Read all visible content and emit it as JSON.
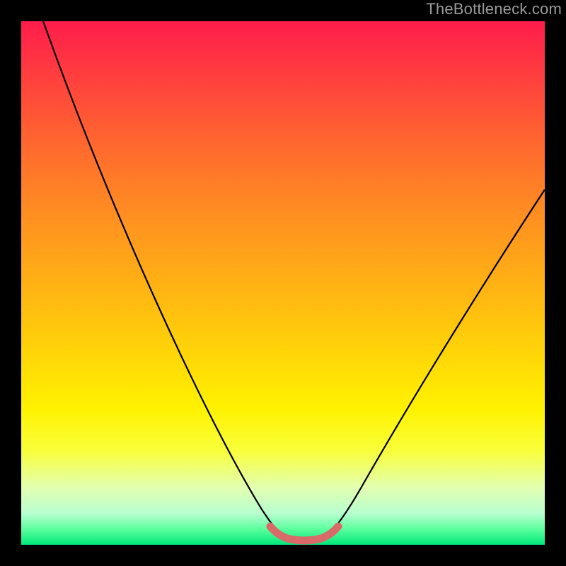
{
  "watermark": "TheBottleneck.com",
  "colors": {
    "background": "#000000",
    "curve_stroke": "#000000",
    "bottom_marker": "#d86a6a",
    "gradient_top": "#ff1c4b",
    "gradient_bottom": "#00e87a"
  },
  "chart_data": {
    "type": "line",
    "title": "",
    "xlabel": "",
    "ylabel": "",
    "xlim": [
      0,
      100
    ],
    "ylim": [
      0,
      100
    ],
    "grid": false,
    "legend": false,
    "series": [
      {
        "name": "bottleneck-curve",
        "x": [
          0,
          5,
          10,
          15,
          20,
          25,
          30,
          35,
          40,
          45,
          48,
          50,
          52,
          55,
          57,
          60,
          65,
          70,
          75,
          80,
          85,
          90,
          95,
          100
        ],
        "y": [
          108,
          99,
          90,
          81,
          72,
          62,
          52,
          42,
          31,
          18,
          9,
          3,
          1,
          0.5,
          0.5,
          1.5,
          6,
          14,
          24,
          34,
          44,
          53,
          61,
          68
        ]
      },
      {
        "name": "bottom-highlight",
        "x": [
          48,
          49,
          50,
          51,
          52,
          53,
          54,
          55,
          56,
          57,
          58,
          59,
          60
        ],
        "y": [
          2.5,
          1.6,
          1.1,
          0.8,
          0.6,
          0.5,
          0.5,
          0.5,
          0.6,
          0.8,
          1.1,
          1.7,
          2.6
        ]
      }
    ],
    "notes": "No axes, ticks, or labels are shown in the source image; x and y values are read from the curve shape on a 0–100 normalized scale where y=0 is the bottom (green) and y≈100 is the top (red). The second series corresponds to the thick muted-red segment along the curve's minimum."
  }
}
